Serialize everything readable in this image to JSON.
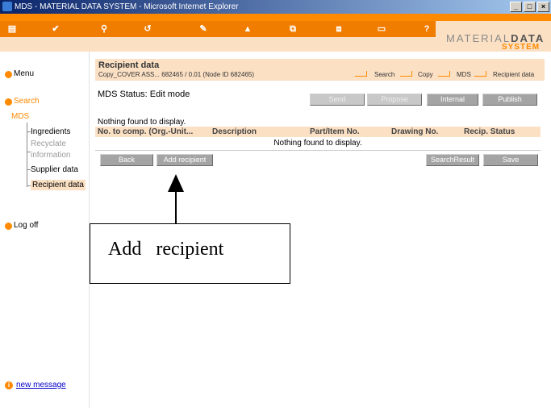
{
  "window": {
    "title": "MDS - MATERIAL DATA SYSTEM - Microsoft Internet Explorer",
    "buttons": [
      "_",
      "□",
      "×"
    ]
  },
  "logo": {
    "material": "MATERIAL",
    "data": "DATA",
    "system": "SYSTEM"
  },
  "toolbar_icons": [
    "document-icon",
    "check-icon",
    "search-icon",
    "back-icon",
    "pen-icon",
    "mountain-icon",
    "copy-icon",
    "paste-icon",
    "print-icon",
    "help-icon"
  ],
  "sidebar": {
    "menu": "Menu",
    "search": "Search",
    "mds": "MDS",
    "items": [
      {
        "label": "Ingredients",
        "state": "normal"
      },
      {
        "label": "Recyclate",
        "state": "dim"
      },
      {
        "label": "information",
        "state": "dim"
      },
      {
        "label": "Supplier data",
        "state": "normal"
      },
      {
        "label": "Recipient data",
        "state": "active"
      }
    ],
    "logoff": "Log off",
    "new_message": "new message"
  },
  "page": {
    "title": "Recipient data",
    "subtitle": "Copy_COVER ASS... 682465 / 0.01 (Node ID 682465)",
    "breadcrumb": [
      "Search",
      "Copy",
      "MDS",
      "Recipient data"
    ],
    "status": "MDS Status: Edit mode"
  },
  "buttons_top": {
    "send": "Send",
    "propose": "Propose",
    "internal": "Internal",
    "publish": "Publish"
  },
  "table": {
    "nothing_above": "Nothing found to display.",
    "headers": [
      "No. to comp. (Org.-Unit...",
      "Description",
      "Part/Item No.",
      "Drawing No.",
      "Recip. Status"
    ],
    "empty_message": "Nothing found to display."
  },
  "buttons_bottom": {
    "back": "Back",
    "add_recipient": "Add recipient",
    "search_result": "SearchResult",
    "save": "Save"
  },
  "annotation": {
    "text": "Add   recipient"
  },
  "colors": {
    "accent": "#ff8a00",
    "header_bg": "#fbe0c4",
    "button": "#a4a4a4"
  }
}
